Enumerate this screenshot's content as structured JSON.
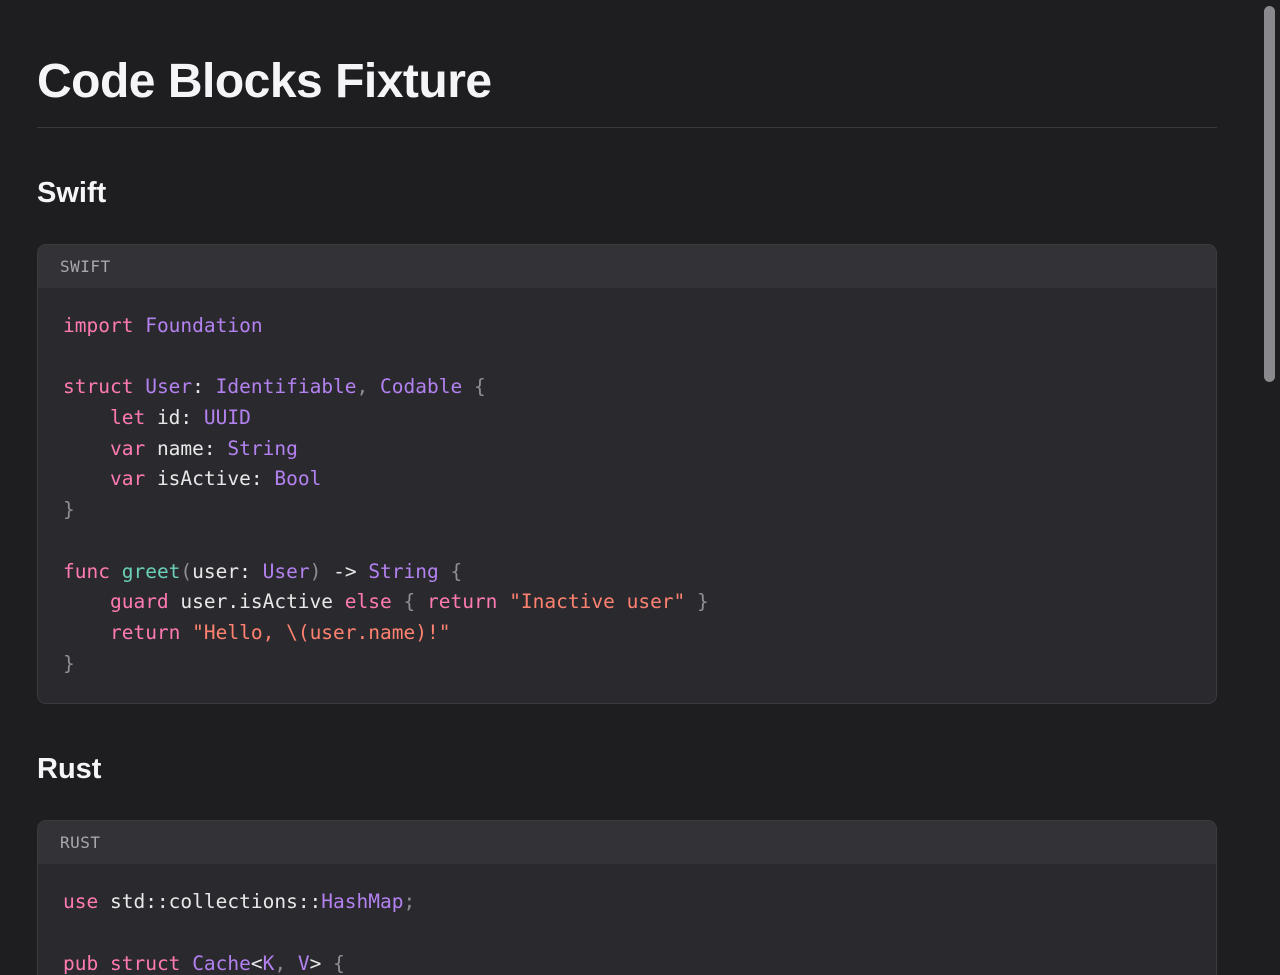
{
  "page": {
    "title": "Code Blocks Fixture"
  },
  "sections": [
    {
      "heading": "Swift",
      "language_label": "SWIFT",
      "lines": [
        [
          {
            "t": "import",
            "c": "kw"
          },
          {
            "t": " ",
            "c": "pl"
          },
          {
            "t": "Foundation",
            "c": "ty"
          }
        ],
        [],
        [
          {
            "t": "struct",
            "c": "kw"
          },
          {
            "t": " ",
            "c": "pl"
          },
          {
            "t": "User",
            "c": "ty"
          },
          {
            "t": ": ",
            "c": "pl"
          },
          {
            "t": "Identifiable",
            "c": "ty"
          },
          {
            "t": ", ",
            "c": "pn"
          },
          {
            "t": "Codable",
            "c": "ty"
          },
          {
            "t": " {",
            "c": "pn"
          }
        ],
        [
          {
            "t": "    ",
            "c": "pl"
          },
          {
            "t": "let",
            "c": "kw"
          },
          {
            "t": " id: ",
            "c": "pl"
          },
          {
            "t": "UUID",
            "c": "ty"
          }
        ],
        [
          {
            "t": "    ",
            "c": "pl"
          },
          {
            "t": "var",
            "c": "kw"
          },
          {
            "t": " name: ",
            "c": "pl"
          },
          {
            "t": "String",
            "c": "ty"
          }
        ],
        [
          {
            "t": "    ",
            "c": "pl"
          },
          {
            "t": "var",
            "c": "kw"
          },
          {
            "t": " isActive: ",
            "c": "pl"
          },
          {
            "t": "Bool",
            "c": "ty"
          }
        ],
        [
          {
            "t": "}",
            "c": "pn"
          }
        ],
        [],
        [
          {
            "t": "func",
            "c": "kw"
          },
          {
            "t": " ",
            "c": "pl"
          },
          {
            "t": "greet",
            "c": "fn"
          },
          {
            "t": "(",
            "c": "pn"
          },
          {
            "t": "user: ",
            "c": "pl"
          },
          {
            "t": "User",
            "c": "ty"
          },
          {
            "t": ")",
            "c": "pn"
          },
          {
            "t": " -> ",
            "c": "pl"
          },
          {
            "t": "String",
            "c": "ty"
          },
          {
            "t": " {",
            "c": "pn"
          }
        ],
        [
          {
            "t": "    ",
            "c": "pl"
          },
          {
            "t": "guard",
            "c": "kw"
          },
          {
            "t": " user.isActive ",
            "c": "pl"
          },
          {
            "t": "else",
            "c": "kw"
          },
          {
            "t": " { ",
            "c": "pn"
          },
          {
            "t": "return",
            "c": "kw"
          },
          {
            "t": " ",
            "c": "pl"
          },
          {
            "t": "\"Inactive user\"",
            "c": "str"
          },
          {
            "t": " }",
            "c": "pn"
          }
        ],
        [
          {
            "t": "    ",
            "c": "pl"
          },
          {
            "t": "return",
            "c": "kw"
          },
          {
            "t": " ",
            "c": "pl"
          },
          {
            "t": "\"Hello, \\(user.name)!\"",
            "c": "str"
          }
        ],
        [
          {
            "t": "}",
            "c": "pn"
          }
        ]
      ]
    },
    {
      "heading": "Rust",
      "language_label": "RUST",
      "lines": [
        [
          {
            "t": "use",
            "c": "kw"
          },
          {
            "t": " std::collections::",
            "c": "pl"
          },
          {
            "t": "HashMap",
            "c": "ty"
          },
          {
            "t": ";",
            "c": "pn"
          }
        ],
        [],
        [
          {
            "t": "pub",
            "c": "kw"
          },
          {
            "t": " ",
            "c": "pl"
          },
          {
            "t": "struct",
            "c": "kw"
          },
          {
            "t": " ",
            "c": "pl"
          },
          {
            "t": "Cache",
            "c": "ty"
          },
          {
            "t": "<",
            "c": "pl"
          },
          {
            "t": "K",
            "c": "ty"
          },
          {
            "t": ", ",
            "c": "pn"
          },
          {
            "t": "V",
            "c": "ty"
          },
          {
            "t": ">",
            "c": "pl"
          },
          {
            "t": " {",
            "c": "pn"
          }
        ]
      ]
    }
  ],
  "colors": {
    "keyword": "#ff7ab2",
    "type": "#b381f0",
    "function": "#6bd0b8",
    "string": "#ff8170",
    "punctuation": "#8e8e94",
    "plain": "#e8e8ea",
    "background": "#1e1e20",
    "code_background": "#2a2a2e"
  }
}
